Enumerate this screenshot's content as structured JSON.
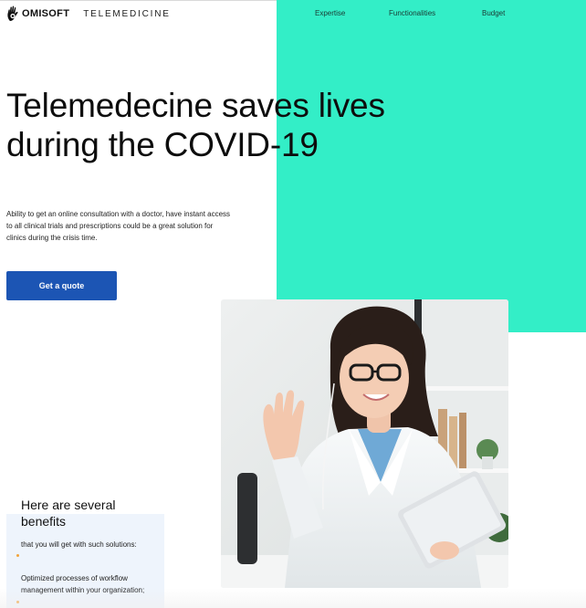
{
  "header": {
    "brand_name": "OMISOFT",
    "brand_subtitle": "TELEMEDICINE",
    "logo_icon": "hand-logo-icon"
  },
  "nav": {
    "items": [
      {
        "label": "Expertise"
      },
      {
        "label": "Functionalities"
      },
      {
        "label": "Budget"
      }
    ]
  },
  "hero": {
    "title": "Telemedecine saves lives during the COVID-19",
    "description": "Ability to get an online consultation with a doctor, have instant access to all clinical trials and prescriptions could be a great solution for clinics during the crisis time.",
    "cta_label": "Get a quote"
  },
  "photo": {
    "subject_icon": "doctor-waving-tablet-photo"
  },
  "benefits": {
    "title": "Here are several benefits",
    "intro": "that you will get with such solutions:",
    "items": [
      {
        "text": "Optimized processes of workflow management within your organization;"
      }
    ]
  },
  "colors": {
    "accent_mint": "#33eec7",
    "cta_blue": "#1c55b4",
    "card_bg": "#eef4fc",
    "bullet_orange": "#f2a33a"
  }
}
